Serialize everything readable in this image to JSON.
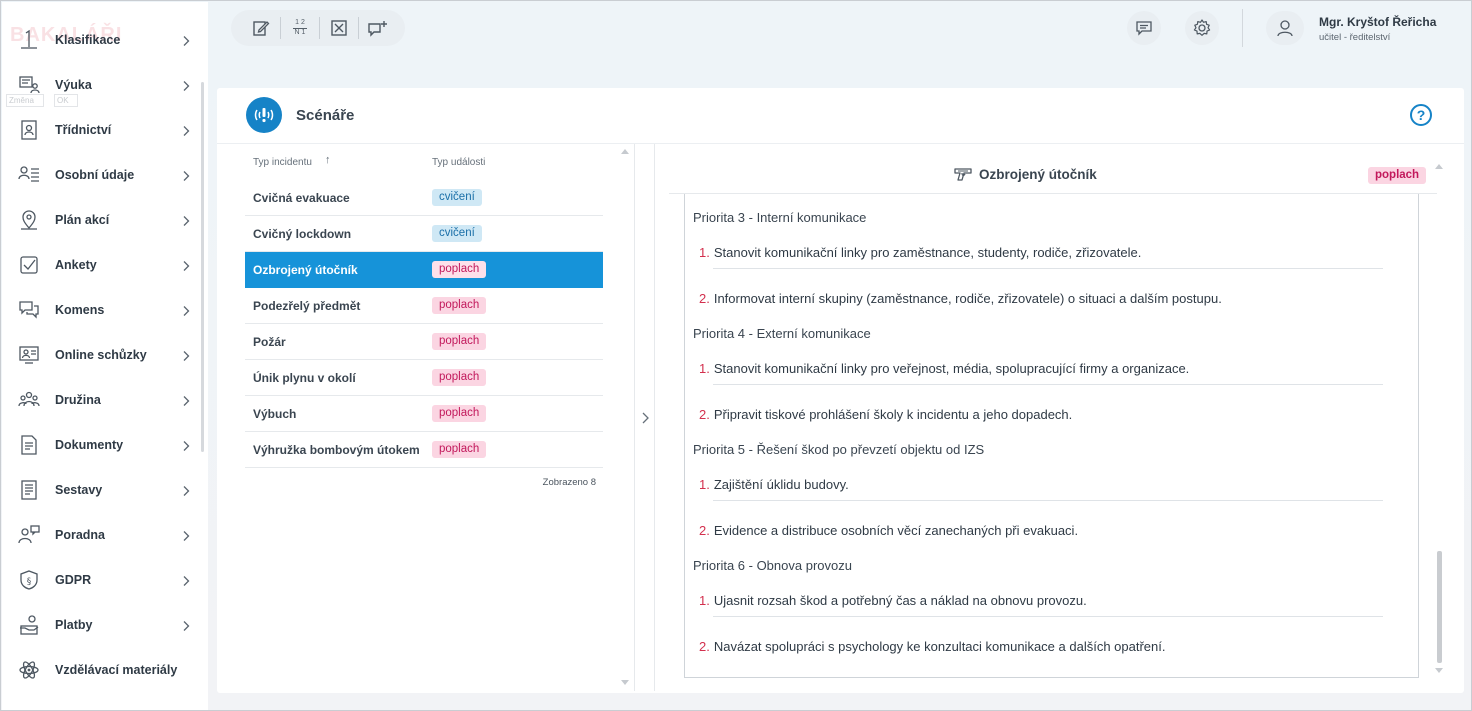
{
  "sidebar": {
    "logo_text": "BAKALÁŘI",
    "ghost_boxes": [
      "Změna",
      "OK"
    ],
    "items": [
      {
        "label": "Klasifikace",
        "icon": "grade-one-icon",
        "chevron": true
      },
      {
        "label": "Výuka",
        "icon": "book-teaching-icon",
        "chevron": true
      },
      {
        "label": "Třídnictví",
        "icon": "class-badge-icon",
        "chevron": true
      },
      {
        "label": "Osobní údaje",
        "icon": "person-list-icon",
        "chevron": true
      },
      {
        "label": "Plán akcí",
        "icon": "map-pin-icon",
        "chevron": true
      },
      {
        "label": "Ankety",
        "icon": "checkbox-icon",
        "chevron": true
      },
      {
        "label": "Komens",
        "icon": "chat-bubbles-icon",
        "chevron": true
      },
      {
        "label": "Online schůzky",
        "icon": "video-meeting-icon",
        "chevron": true
      },
      {
        "label": "Družina",
        "icon": "group-people-icon",
        "chevron": true
      },
      {
        "label": "Dokumenty",
        "icon": "document-icon",
        "chevron": true
      },
      {
        "label": "Sestavy",
        "icon": "report-list-icon",
        "chevron": true
      },
      {
        "label": "Poradna",
        "icon": "counseling-icon",
        "chevron": true
      },
      {
        "label": "GDPR",
        "icon": "shield-paragraph-icon",
        "chevron": true
      },
      {
        "label": "Platby",
        "icon": "payment-hand-icon",
        "chevron": true
      },
      {
        "label": "Vzdělávací materiály",
        "icon": "atom-icon",
        "chevron": false
      }
    ]
  },
  "toolbar": {
    "buttons": [
      "edit-icon",
      "fraction-icon",
      "cancel-box-icon",
      "add-comment-icon"
    ],
    "fraction_top": "1 2",
    "fraction_bottom": "N 1"
  },
  "header": {
    "user_name": "Mgr. Kryštof Řeřicha",
    "user_role": "učitel - ředitelství"
  },
  "page": {
    "title": "Scénáře",
    "help_label": "?"
  },
  "list": {
    "col_incident": "Typ incidentu",
    "col_event": "Typ události",
    "sort_arrow": "↑",
    "rows": [
      {
        "name": "Cvičná evakuace",
        "type": "cvičení"
      },
      {
        "name": "Cvičný lockdown",
        "type": "cvičení"
      },
      {
        "name": "Ozbrojený útočník",
        "type": "poplach"
      },
      {
        "name": "Podezřelý předmět",
        "type": "poplach"
      },
      {
        "name": "Požár",
        "type": "poplach"
      },
      {
        "name": "Únik plynu v okolí",
        "type": "poplach"
      },
      {
        "name": "Výbuch",
        "type": "poplach"
      },
      {
        "name": "Výhružka bombovým útokem",
        "type": "poplach"
      }
    ],
    "selected_index": 2,
    "count_text": "Zobrazeno 8"
  },
  "detail": {
    "title": "Ozbrojený útočník",
    "tag": "poplach",
    "priorities": [
      {
        "heading": "Priorita 3 - Interní komunikace",
        "steps": [
          "Stanovit komunikační linky pro zaměstnance, studenty, rodiče, zřizovatele.",
          "Informovat interní skupiny (zaměstnance, rodiče, zřizovatele) o situaci a dalším postupu."
        ]
      },
      {
        "heading": "Priorita 4 - Externí komunikace",
        "steps": [
          "Stanovit komunikační linky pro veřejnost, média, spolupracující firmy a organizace.",
          "Připravit tiskové prohlášení školy k incidentu a jeho dopadech."
        ]
      },
      {
        "heading": "Priorita 5 - Řešení škod po převzetí objektu od IZS",
        "steps": [
          "Zajištění úklidu budovy.",
          "Evidence a distribuce osobních věcí zanechaných při evakuaci."
        ]
      },
      {
        "heading": "Priorita 6 - Obnova provozu",
        "steps": [
          "Ujasnit rozsah škod a potřebný čas a náklad na obnovu provozu.",
          "Navázat spolupráci s psychology ke konzultaci komunikace a dalších opatření."
        ]
      }
    ],
    "step_numbers": [
      "1.",
      "2."
    ]
  },
  "colors": {
    "accent": "#1693d9",
    "alarm_bg": "#fbd5e2",
    "alarm_text": "#c2185b",
    "drill_bg": "#cfe8f5",
    "drill_text": "#1a6fa8",
    "step_number": "#d3304e"
  }
}
